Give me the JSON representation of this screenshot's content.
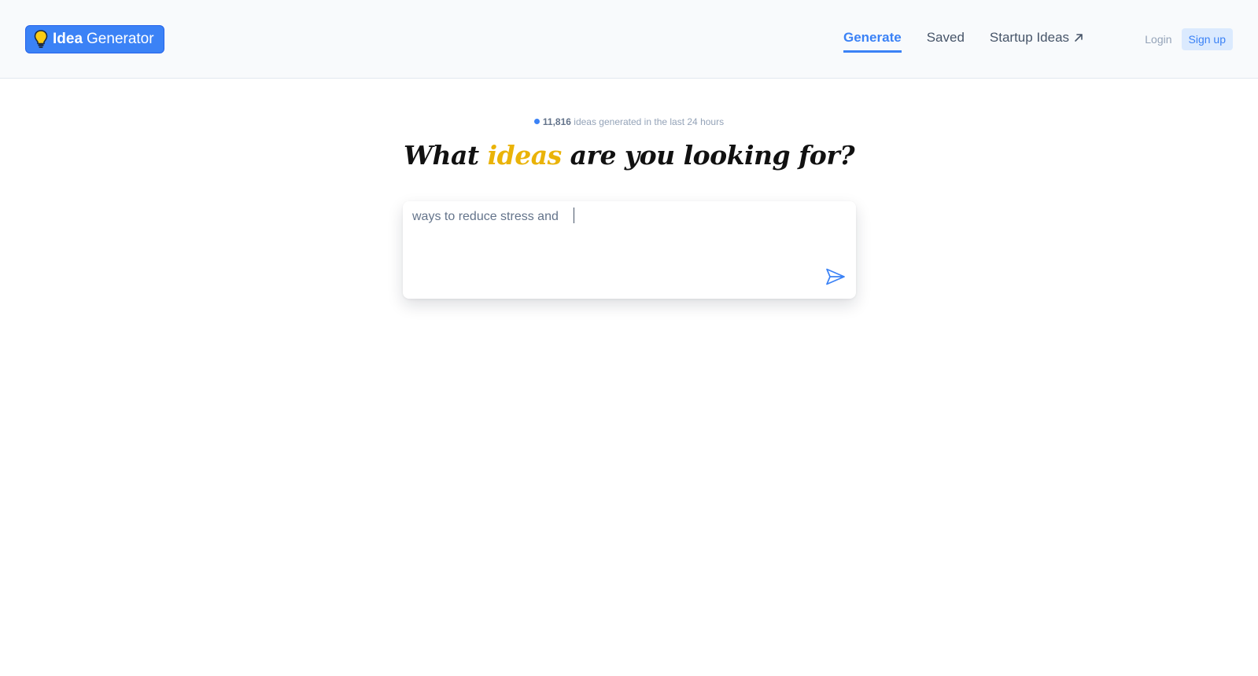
{
  "header": {
    "logo": {
      "bold": "Idea",
      "light": "Generator",
      "icon": "lightbulb-icon"
    },
    "nav": [
      {
        "label": "Generate",
        "active": true
      },
      {
        "label": "Saved",
        "active": false
      },
      {
        "label": "Startup Ideas",
        "active": false,
        "icon": "external-arrow-icon"
      }
    ],
    "auth": {
      "login": "Login",
      "signup": "Sign up"
    }
  },
  "counter": {
    "count": "11,816",
    "suffix": "ideas generated in the last 24 hours"
  },
  "headline": {
    "part1": "What ",
    "accent": "ideas",
    "part2": " are you looking for?"
  },
  "prompt": {
    "value": "ways to reduce stress and ",
    "send_icon": "send-icon"
  },
  "colors": {
    "brand": "#3b82f6",
    "accent": "#eab308"
  }
}
